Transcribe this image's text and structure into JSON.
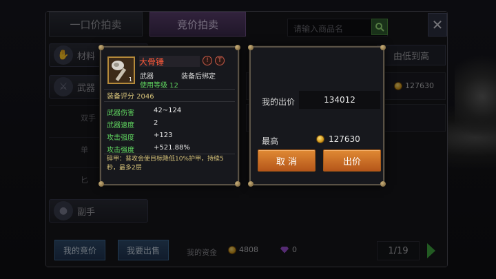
{
  "tabs": {
    "fixed_price": "一口价拍卖",
    "bidding": "竞价拍卖"
  },
  "search": {
    "placeholder": "请输入商品名"
  },
  "sidebar": {
    "items": [
      {
        "label": "材料"
      },
      {
        "label": "武器"
      },
      {
        "label": "双手"
      },
      {
        "label": "单"
      },
      {
        "label": "匕"
      },
      {
        "label": "副手"
      }
    ]
  },
  "sort": {
    "label": "由低到高"
  },
  "listing_rows": [
    {
      "price": "127630"
    },
    {
      "price": ""
    }
  ],
  "bottom": {
    "my_bids": "我的竞价",
    "sell": "我要出售",
    "funds_label": "我的资金",
    "gold": "4808",
    "gems": "0"
  },
  "pagination": {
    "page": "1/19"
  },
  "item": {
    "name": "大骨锤",
    "count": "1",
    "type": "武器",
    "bind": "装备后绑定",
    "level_label": "使用等级 12",
    "score_label": "装备评分 2046",
    "stats": [
      {
        "label": "武器伤害",
        "value": "42~124"
      },
      {
        "label": "武器速度",
        "value": "2"
      },
      {
        "label": "攻击强度",
        "value": "+123"
      },
      {
        "label": "攻击强度",
        "value": "+521.88%"
      }
    ],
    "effect": "碎甲：普攻会使目标降低10%护甲，持续5秒，最多2层"
  },
  "bid": {
    "my_bid_label": "我的出价",
    "my_bid_value": "134012",
    "max_label": "最高",
    "max_value": "127630",
    "cancel": "取 消",
    "submit": "出价"
  },
  "colors": {
    "accent_orange": "#d67a2a",
    "stat_green": "#5fd35f",
    "item_red": "#ff5a3a",
    "gold_text": "#d7c37a"
  }
}
